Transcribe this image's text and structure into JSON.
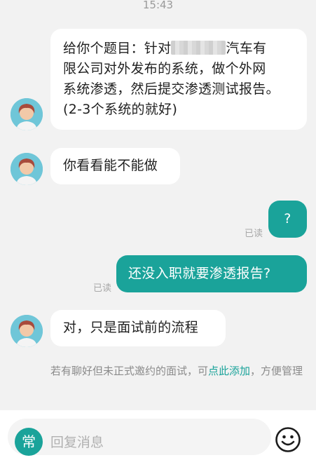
{
  "timestamp": "15:43",
  "messages": {
    "m1": {
      "line1_pre": "给你个题目：针对",
      "line1_post": "汽车有",
      "line2": "限公司对外发布的系统，做个外网",
      "line3": "系统渗透，然后提交渗透测试报告。",
      "line4": "(2-3个系统的就好)"
    },
    "m2": "你看看能不能做",
    "m3": "?",
    "m4": "还没入职就要渗透报告?",
    "m5": "对，只是面试前的流程"
  },
  "read_label": "已读",
  "notice": {
    "text_before": "若有聊好但未正式邀约的面试，可",
    "link": "点此添加",
    "text_after": "，方便管理"
  },
  "input": {
    "shortcut_label": "常",
    "placeholder": "回复消息"
  },
  "colors": {
    "accent": "#1aa39a",
    "background": "#f2f2f2"
  },
  "icons": {
    "emoji": "smiley-face-icon",
    "avatar": "person-avatar-icon"
  }
}
